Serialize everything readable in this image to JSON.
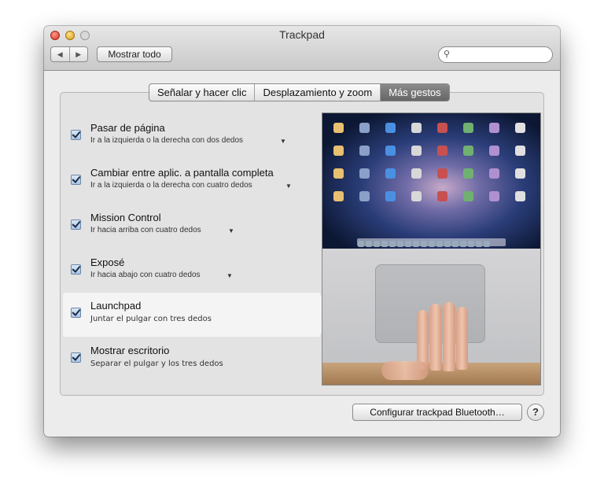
{
  "window": {
    "title": "Trackpad"
  },
  "toolbar": {
    "back_icon": "triangle-left-icon",
    "forward_icon": "triangle-right-icon",
    "show_all_label": "Mostrar todo",
    "search_value": "",
    "search_icon": "magnifier-icon"
  },
  "tabs": [
    {
      "label": "Señalar y hacer clic",
      "selected": false
    },
    {
      "label": "Desplazamiento y zoom",
      "selected": false
    },
    {
      "label": "Más gestos",
      "selected": true
    }
  ],
  "gestures": [
    {
      "title": "Pasar de página",
      "subtitle": "Ir a la izquierda  o la derecha con dos dedos",
      "checked": true,
      "has_dropdown": true
    },
    {
      "title": "Cambiar entre aplic. a pantalla completa",
      "subtitle": "Ir a la izquierda o la derecha con cuatro dedos",
      "checked": true,
      "has_dropdown": true
    },
    {
      "title": "Mission Control",
      "subtitle": "Ir hacia arriba con cuatro dedos",
      "checked": true,
      "has_dropdown": true
    },
    {
      "title": "Exposé",
      "subtitle": "Ir hacia abajo con cuatro dedos",
      "checked": true,
      "has_dropdown": true
    },
    {
      "title": "Launchpad",
      "subtitle": "Juntar el pulgar con tres dedos",
      "checked": true,
      "has_dropdown": false,
      "selected": true
    },
    {
      "title": "Mostrar escritorio",
      "subtitle": "Separar el pulgar y los tres dedos",
      "checked": true,
      "has_dropdown": false
    }
  ],
  "footer": {
    "bluetooth_button": "Configurar trackpad Bluetooth…",
    "help_label": "?"
  },
  "colors": {
    "selected_tab": "#777777",
    "checkbox": "#a9c4e4",
    "window_bg": "#ececec"
  }
}
